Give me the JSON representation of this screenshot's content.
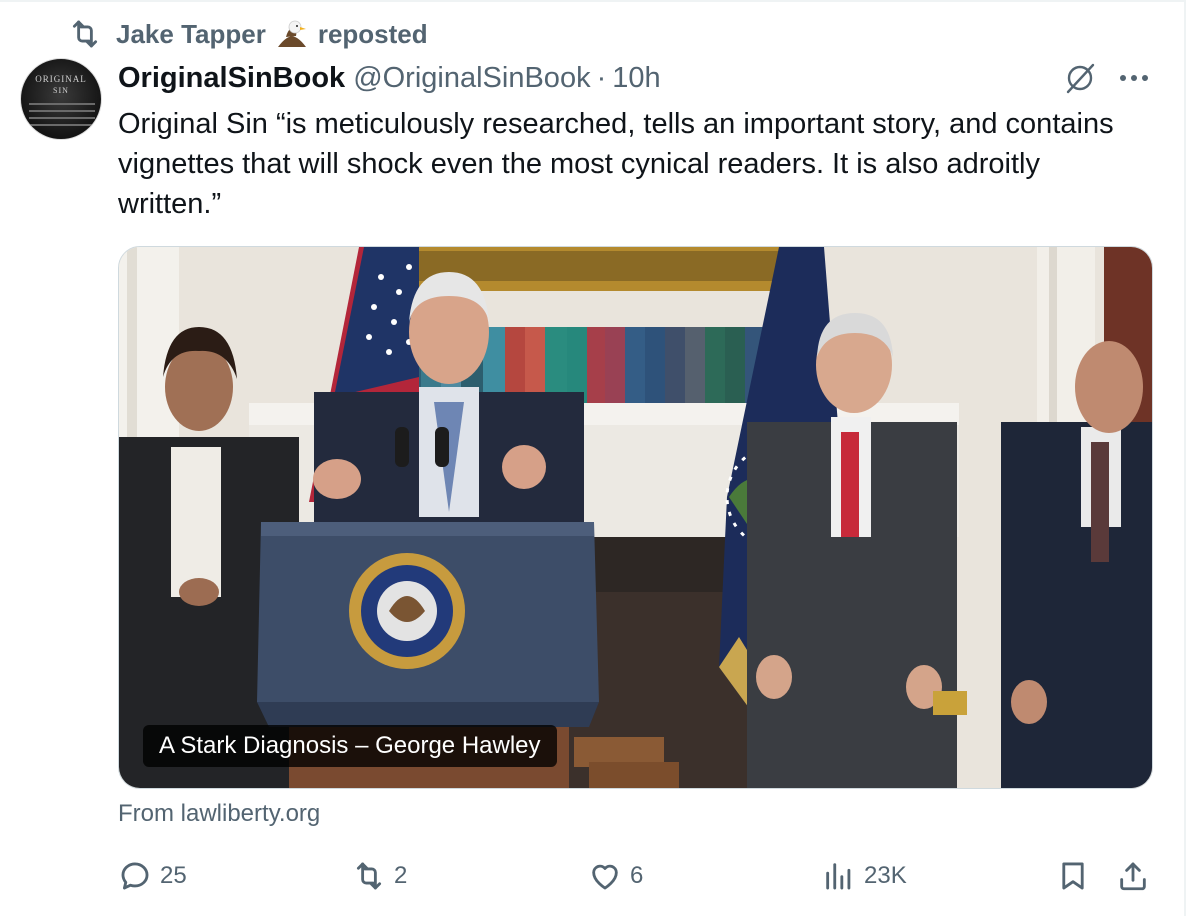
{
  "repost": {
    "user": "Jake Tapper",
    "badge_icon": "eagle-emoji",
    "label": "reposted"
  },
  "tweet": {
    "author_name": "OriginalSinBook",
    "handle": "@OriginalSinBook",
    "separator": "·",
    "time": "10h",
    "text": "Original Sin “is meticulously researched, tells an important story, and contains vignettes that will shock even the most cynical readers. It is also adroitly written.”",
    "avatar": {
      "title_line1": "ORIGINAL",
      "title_line2": "SIN"
    }
  },
  "card": {
    "caption": "A Stark Diagnosis – George Hawley",
    "source": "From lawliberty.org"
  },
  "actions": {
    "replies": "25",
    "reposts": "2",
    "likes": "6",
    "views": "23K"
  },
  "colors": {
    "text_primary": "#0f1419",
    "text_secondary": "#536471",
    "border": "#cfd9de",
    "podium": "#3d4d68",
    "flag_blue": "#1f3466",
    "flag_red": "#b3263a"
  }
}
